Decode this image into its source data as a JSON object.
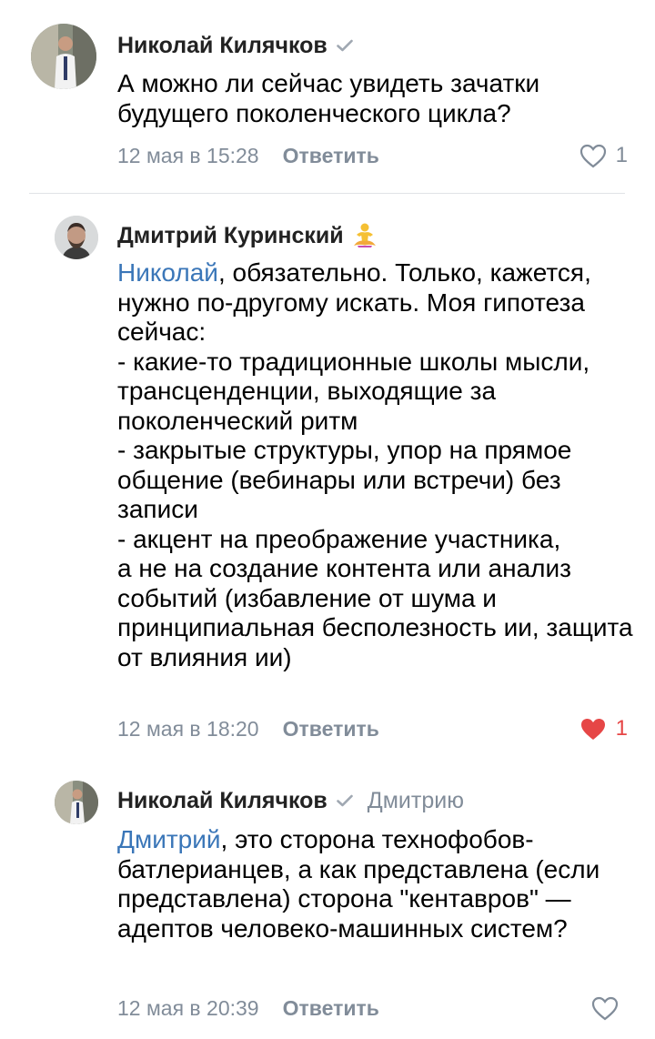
{
  "comments": [
    {
      "author": "Николай Килячков",
      "verified": true,
      "text": "А можно ли сейчас увидеть зачатки будущего поколенческого цикла?",
      "date": "12 мая в 15:28",
      "reply_label": "Ответить",
      "likes": "1",
      "liked": false
    },
    {
      "author": "Дмитрий Куринский",
      "emoji": "person-in-lotus-position-emoji",
      "mention": "Николай",
      "text": ", обязательно. Только, кажется, нужно по-другому искать. Моя гипотеза сейчас:\n- какие-то традиционные школы мысли, трансценденции, выходящие за поколенческий ритм\n- закрытые структуры, упор на прямое общение (вебинары или встречи) без записи\n- акцент на преображение участника,\nа не на создание контента или анализ событий (избавление от шума и принципиальная бесполезность ии, защита от влияния ии)",
      "date": "12 мая в 18:20",
      "reply_label": "Ответить",
      "likes": "1",
      "liked": true
    },
    {
      "author": "Николай Килячков",
      "verified": true,
      "reply_to": "Дмитрию",
      "mention": "Дмитрий",
      "text": ", это сторона технофобов-батлерианцев, а как представлена (если представлена) сторона \"кентавров\" — адептов человеко-машинных систем?",
      "date": "12 мая в 20:39",
      "reply_label": "Ответить",
      "likes": "",
      "liked": false
    }
  ],
  "colors": {
    "mention": "#3a76b8",
    "meta": "#818c99",
    "liked": "#e64646",
    "divider": "#e1e3e6"
  }
}
